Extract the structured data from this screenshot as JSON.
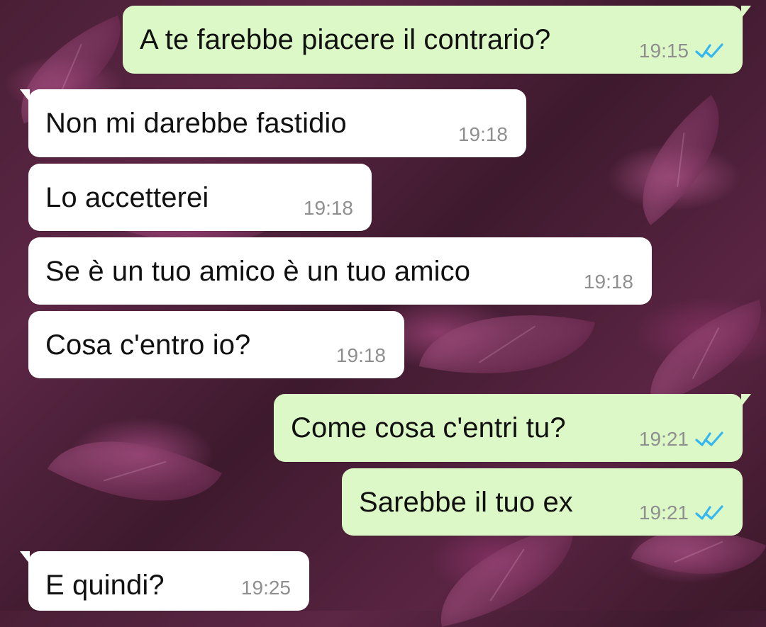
{
  "chat": {
    "messages": [
      {
        "text": "A te farebbe piacere il contrario?",
        "time": "19:15",
        "direction": "outgoing",
        "read": true
      },
      {
        "text": "Non mi darebbe fastidio",
        "time": "19:18",
        "direction": "incoming"
      },
      {
        "text": "Lo accetterei",
        "time": "19:18",
        "direction": "incoming"
      },
      {
        "text": "Se è un tuo amico è un tuo amico",
        "time": "19:18",
        "direction": "incoming"
      },
      {
        "text": "Cosa c'entro io?",
        "time": "19:18",
        "direction": "incoming"
      },
      {
        "text": "Come cosa c'entri tu?",
        "time": "19:21",
        "direction": "outgoing",
        "read": true
      },
      {
        "text": "Sarebbe il tuo ex",
        "time": "19:21",
        "direction": "outgoing",
        "read": true
      },
      {
        "text": "E quindi?",
        "time": "19:25",
        "direction": "incoming"
      }
    ]
  },
  "colors": {
    "incoming_bubble": "#ffffff",
    "outgoing_bubble": "#dcf8c6",
    "timestamp": "#8f8f8f",
    "read_ticks": "#34b7f1",
    "background_base": "#4a1f36"
  },
  "icons": {
    "read_receipt": "double-check-icon"
  }
}
